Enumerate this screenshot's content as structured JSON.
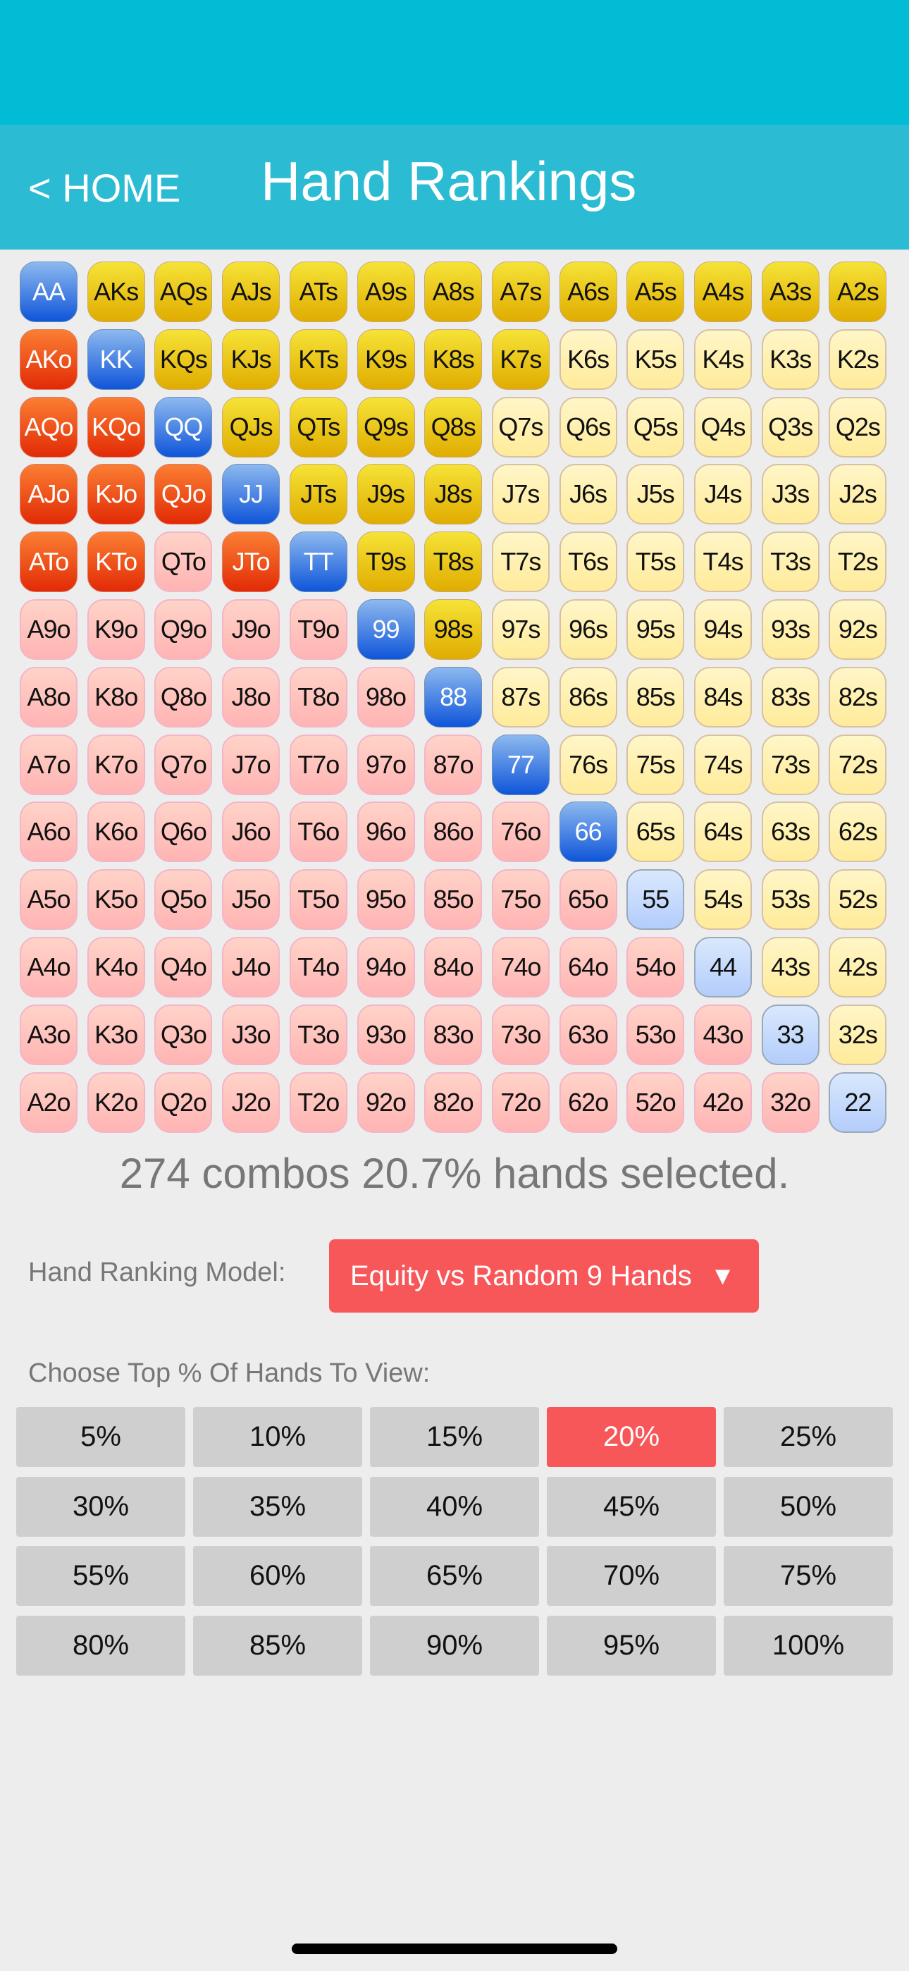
{
  "header": {
    "back_label": "< HOME",
    "title": "Hand Rankings"
  },
  "colors": {
    "status_bar": "#02bcd6",
    "nav_bar": "#2bbcd4",
    "accent_red": "#f8575a",
    "pair_selected": "#2f6fe0",
    "suited_selected": "#eec512",
    "offsuit_selected": "#f04d18",
    "pair_unselected": "#c6dafc",
    "suited_unselected": "#fff1b0",
    "offsuit_unselected": "#ffc3be"
  },
  "grid": {
    "rows": [
      [
        "AA",
        "AKs",
        "AQs",
        "AJs",
        "ATs",
        "A9s",
        "A8s",
        "A7s",
        "A6s",
        "A5s",
        "A4s",
        "A3s",
        "A2s"
      ],
      [
        "AKo",
        "KK",
        "KQs",
        "KJs",
        "KTs",
        "K9s",
        "K8s",
        "K7s",
        "K6s",
        "K5s",
        "K4s",
        "K3s",
        "K2s"
      ],
      [
        "AQo",
        "KQo",
        "QQ",
        "QJs",
        "QTs",
        "Q9s",
        "Q8s",
        "Q7s",
        "Q6s",
        "Q5s",
        "Q4s",
        "Q3s",
        "Q2s"
      ],
      [
        "AJo",
        "KJo",
        "QJo",
        "JJ",
        "JTs",
        "J9s",
        "J8s",
        "J7s",
        "J6s",
        "J5s",
        "J4s",
        "J3s",
        "J2s"
      ],
      [
        "ATo",
        "KTo",
        "QTo",
        "JTo",
        "TT",
        "T9s",
        "T8s",
        "T7s",
        "T6s",
        "T5s",
        "T4s",
        "T3s",
        "T2s"
      ],
      [
        "A9o",
        "K9o",
        "Q9o",
        "J9o",
        "T9o",
        "99",
        "98s",
        "97s",
        "96s",
        "95s",
        "94s",
        "93s",
        "92s"
      ],
      [
        "A8o",
        "K8o",
        "Q8o",
        "J8o",
        "T8o",
        "98o",
        "88",
        "87s",
        "86s",
        "85s",
        "84s",
        "83s",
        "82s"
      ],
      [
        "A7o",
        "K7o",
        "Q7o",
        "J7o",
        "T7o",
        "97o",
        "87o",
        "77",
        "76s",
        "75s",
        "74s",
        "73s",
        "72s"
      ],
      [
        "A6o",
        "K6o",
        "Q6o",
        "J6o",
        "T6o",
        "96o",
        "86o",
        "76o",
        "66",
        "65s",
        "64s",
        "63s",
        "62s"
      ],
      [
        "A5o",
        "K5o",
        "Q5o",
        "J5o",
        "T5o",
        "95o",
        "85o",
        "75o",
        "65o",
        "55",
        "54s",
        "53s",
        "52s"
      ],
      [
        "A4o",
        "K4o",
        "Q4o",
        "J4o",
        "T4o",
        "94o",
        "84o",
        "74o",
        "64o",
        "54o",
        "44",
        "43s",
        "42s"
      ],
      [
        "A3o",
        "K3o",
        "Q3o",
        "J3o",
        "T3o",
        "93o",
        "83o",
        "73o",
        "63o",
        "53o",
        "43o",
        "33",
        "32s"
      ],
      [
        "A2o",
        "K2o",
        "Q2o",
        "J2o",
        "T2o",
        "92o",
        "82o",
        "72o",
        "62o",
        "52o",
        "42o",
        "32o",
        "22"
      ]
    ],
    "selected": [
      "AA",
      "KK",
      "QQ",
      "JJ",
      "TT",
      "99",
      "88",
      "77",
      "66",
      "AKs",
      "AQs",
      "AJs",
      "ATs",
      "A9s",
      "A8s",
      "A7s",
      "A6s",
      "A5s",
      "A4s",
      "A3s",
      "A2s",
      "KQs",
      "KJs",
      "KTs",
      "K9s",
      "K8s",
      "K7s",
      "QJs",
      "QTs",
      "Q9s",
      "Q8s",
      "JTs",
      "J9s",
      "J8s",
      "T9s",
      "T8s",
      "98s",
      "AKo",
      "AQo",
      "AJo",
      "ATo",
      "KQo",
      "KJo",
      "KTo",
      "QJo",
      "JTo"
    ]
  },
  "summary": "274 combos 20.7% hands selected.",
  "model": {
    "label": "Hand Ranking Model:",
    "selected_value": "Equity vs Random 9 Hands",
    "arrow": "▼"
  },
  "percent_picker": {
    "label": "Choose Top % Of Hands To View:",
    "options": [
      "5%",
      "10%",
      "15%",
      "20%",
      "25%",
      "30%",
      "35%",
      "40%",
      "45%",
      "50%",
      "55%",
      "60%",
      "65%",
      "70%",
      "75%",
      "80%",
      "85%",
      "90%",
      "95%",
      "100%"
    ],
    "selected": "20%"
  }
}
